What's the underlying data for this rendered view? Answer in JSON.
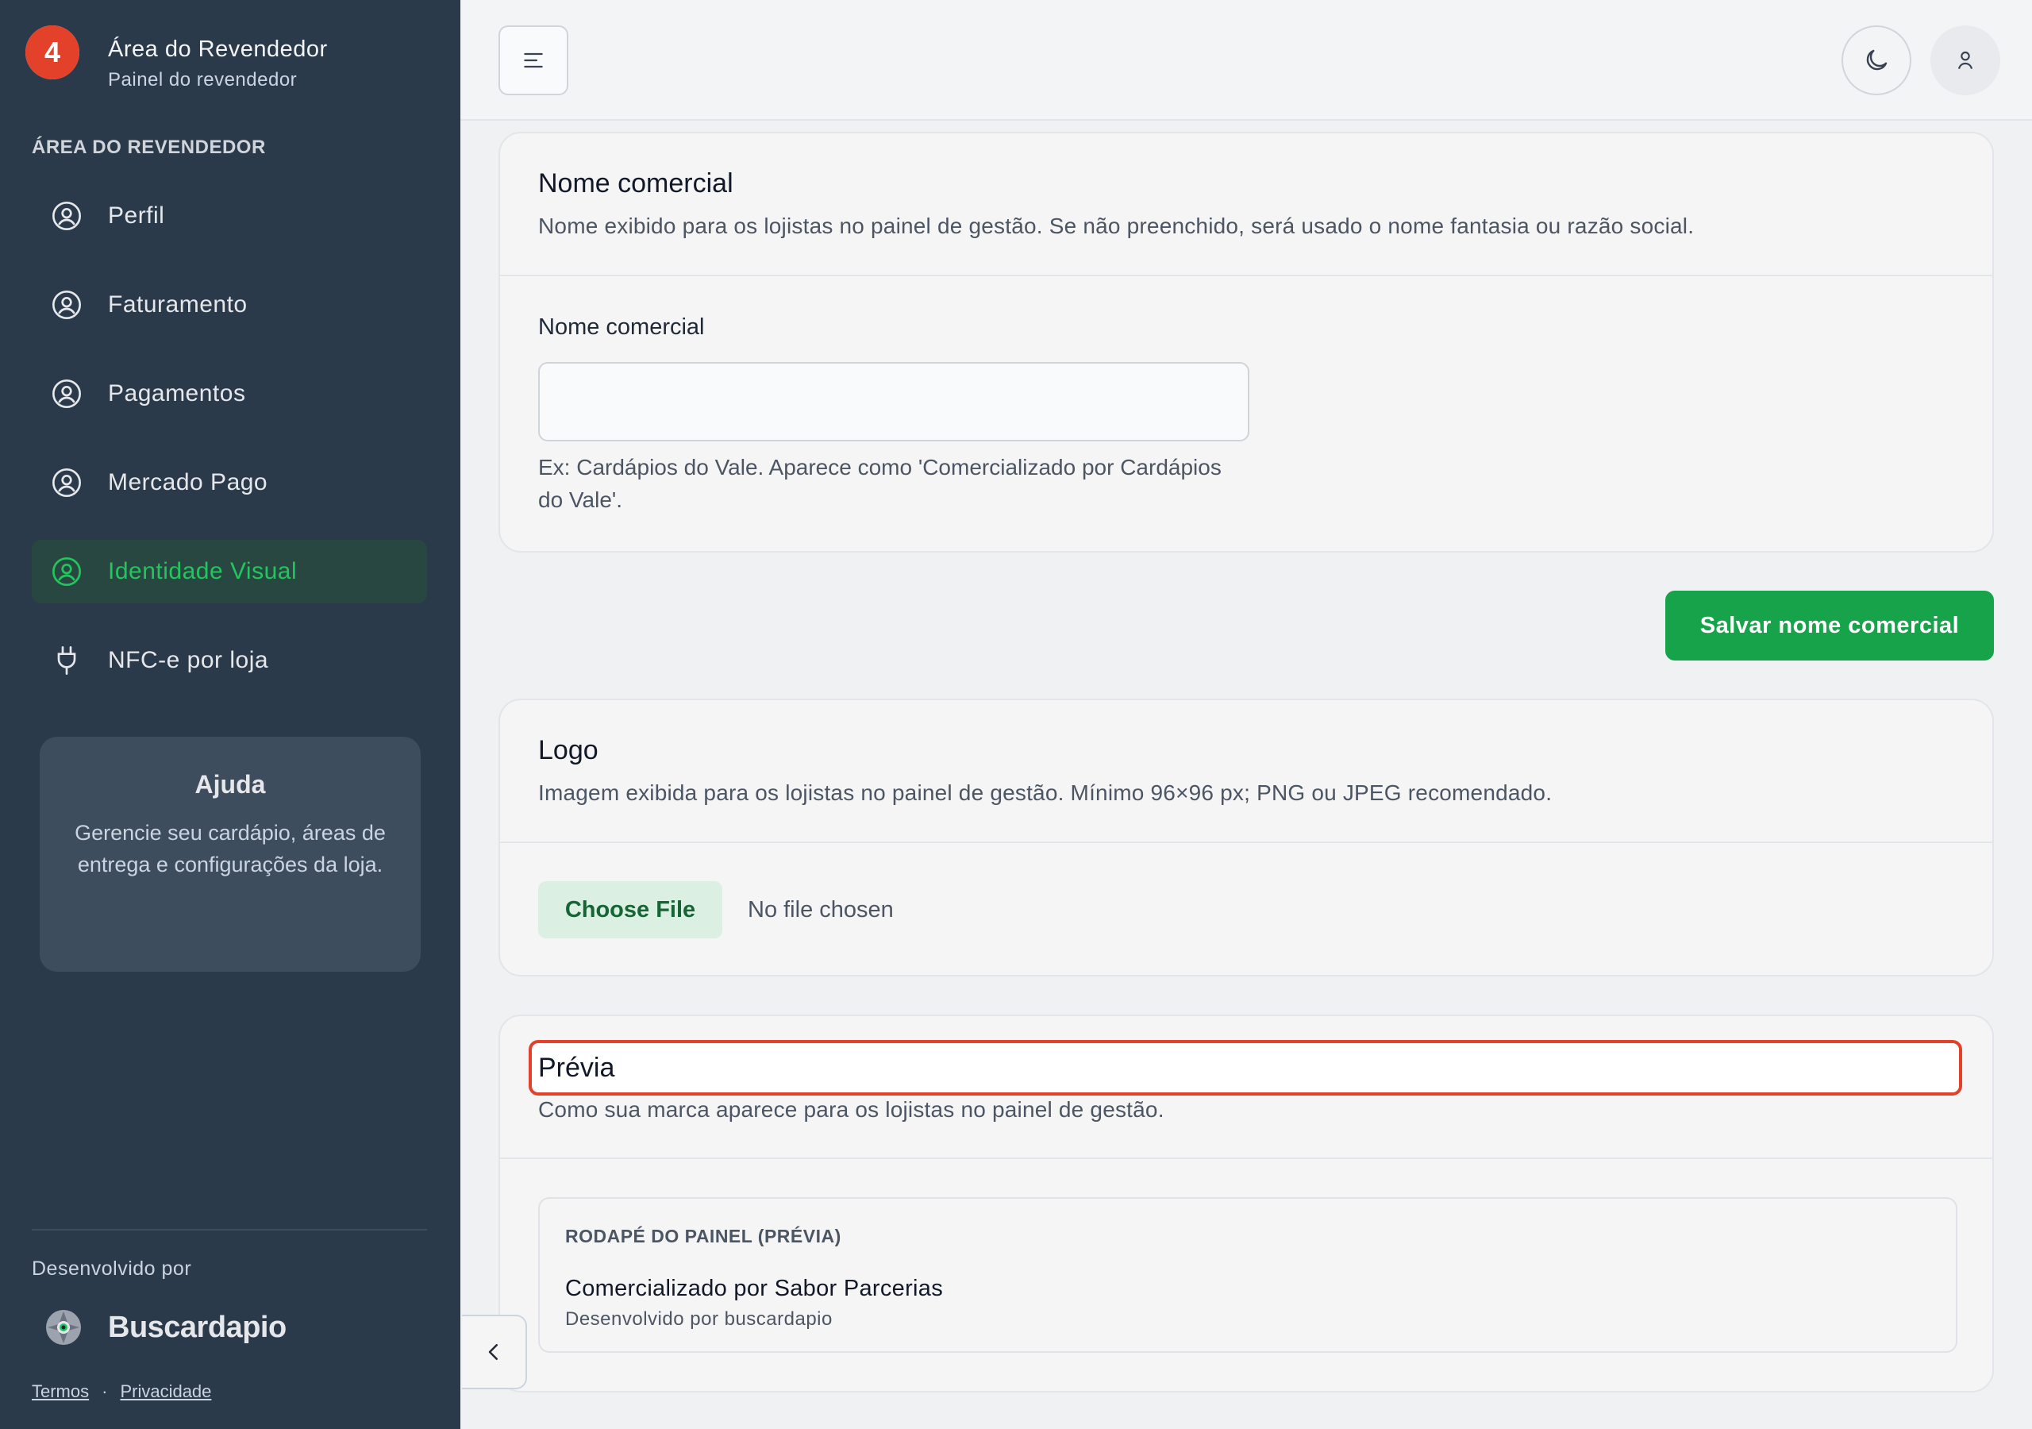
{
  "sidebar": {
    "brand": {
      "badge": "4",
      "title": "Área do Revendedor",
      "subtitle": "Painel do revendedor"
    },
    "section_label": "ÁREA DO REVENDEDOR",
    "items": [
      {
        "label": "Perfil",
        "icon": "user-circle-icon"
      },
      {
        "label": "Faturamento",
        "icon": "user-circle-icon"
      },
      {
        "label": "Pagamentos",
        "icon": "user-circle-icon"
      },
      {
        "label": "Mercado Pago",
        "icon": "user-circle-icon"
      },
      {
        "label": "Identidade Visual",
        "icon": "user-circle-icon",
        "active": true
      },
      {
        "label": "NFC-e por loja",
        "icon": "plug-icon"
      }
    ],
    "help": {
      "title": "Ajuda",
      "text": "Gerencie seu cardápio, áreas de entrega e configurações da loja."
    },
    "developed_by": "Desenvolvido por",
    "dev_brand": "Buscardapio",
    "links": {
      "terms": "Termos",
      "separator": "·",
      "privacy": "Privacidade"
    }
  },
  "topbar": {
    "menu_icon": "menu-icon",
    "theme_icon": "moon-icon",
    "user_icon": "user-icon"
  },
  "commercial_name": {
    "title": "Nome comercial",
    "description": "Nome exibido para os lojistas no painel de gestão. Se não preenchido, será usado o nome fantasia ou razão social.",
    "field_label": "Nome comercial",
    "value": "",
    "hint": "Ex: Cardápios do Vale. Aparece como 'Comercializado por Cardápios do Vale'.",
    "save_label": "Salvar nome comercial"
  },
  "logo": {
    "title": "Logo",
    "description": "Imagem exibida para os lojistas no painel de gestão. Mínimo 96×96 px; PNG ou JPEG recomendado.",
    "choose_label": "Choose File",
    "file_status": "No file chosen"
  },
  "preview": {
    "title": "Prévia",
    "description": "Como sua marca aparece para os lojistas no painel de gestão.",
    "footer_label": "RODAPÉ DO PAINEL (PRÉVIA)",
    "footer_main": "Comercializado por Sabor Parcerias",
    "footer_sub": "Desenvolvido por buscardapio"
  },
  "colors": {
    "sidebar_bg": "#2b3a4a",
    "accent_green": "#16a34a",
    "active_text": "#22c55e",
    "badge_red": "#e4412a"
  }
}
